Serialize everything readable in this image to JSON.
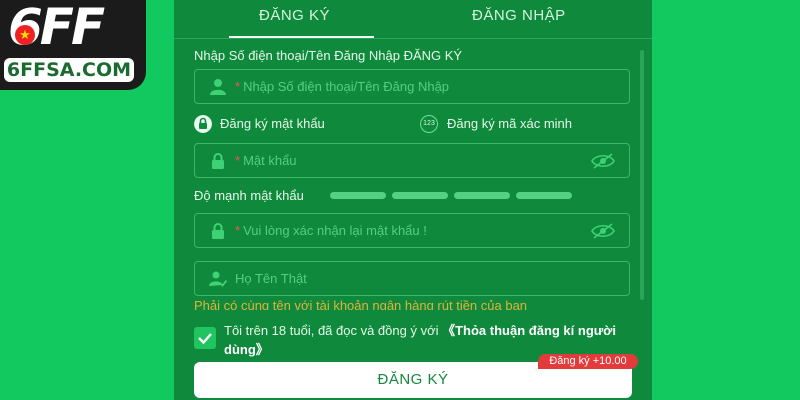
{
  "logo": {
    "main": "6FF",
    "domain": "6FFSA.COM"
  },
  "tabs": [
    {
      "label": "ĐĂNG KÝ",
      "active": true
    },
    {
      "label": "ĐĂNG NHẬP",
      "active": false
    }
  ],
  "form": {
    "username_label": "Nhập Số điện thoại/Tên Đăng Nhập ĐĂNG KÝ",
    "username_placeholder": "Nhập Số điện thoại/Tên Đăng Nhập",
    "option_password": "Đăng ký mật khẩu",
    "option_code_icon": "123",
    "option_code": "Đăng ký mã xác minh",
    "password_placeholder": "Mật khẩu",
    "strength_label": "Độ mạnh mật khẩu",
    "confirm_placeholder": "Vui lòng xác nhận lại mật khẩu !",
    "realname_placeholder": "Họ Tên Thật",
    "realname_warning": "Phải có cùng tên với tài khoản ngân hàng rút tiền của bạn",
    "agree_text": "Tôi trên 18 tuổi, đã đọc và đồng ý với",
    "agree_link": "《Thỏa thuận đăng kí người dùng》",
    "submit_label": "ĐĂNG KÝ",
    "bonus_badge": "Đăng ký +10.00"
  },
  "colors": {
    "accent": "#12c95f",
    "panel": "#0f8a3c",
    "required": "#e55555",
    "warning": "#e0b23a",
    "badge": "#e23b3b"
  }
}
